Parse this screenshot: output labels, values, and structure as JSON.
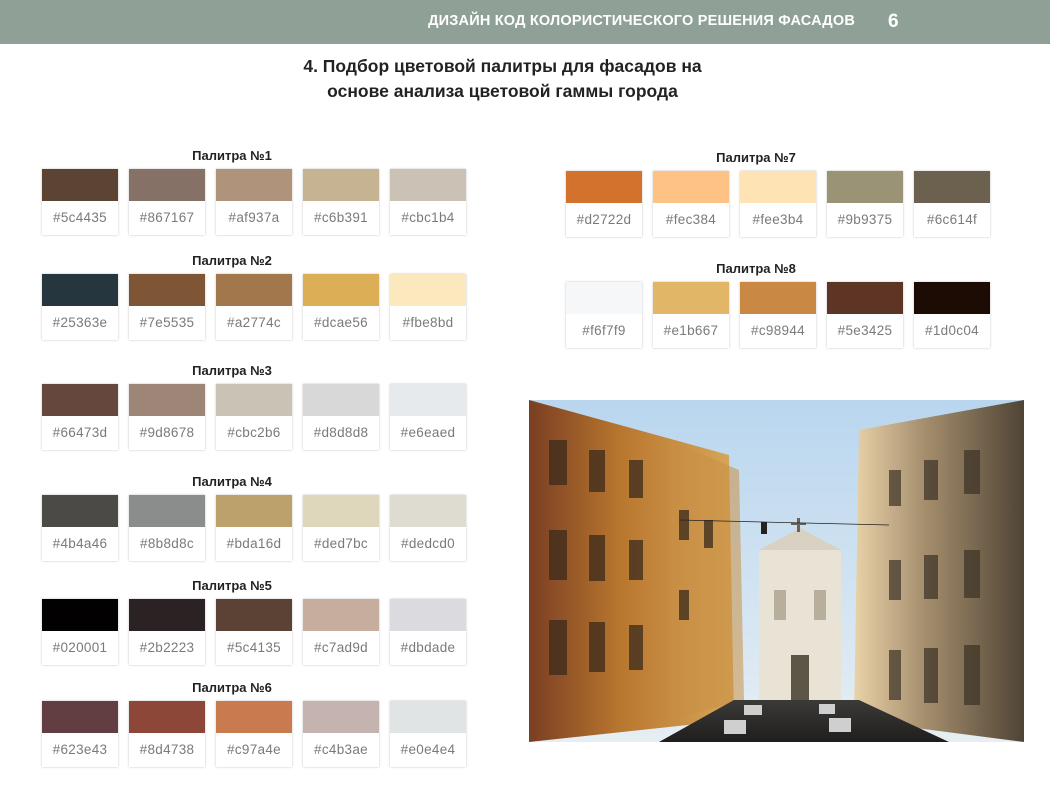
{
  "header": {
    "title": "ДИЗАЙН КОД КОЛОРИСТИЧЕСКОГО РЕШЕНИЯ ФАСАДОВ",
    "page_number": "6"
  },
  "section": {
    "title_line1": "4.  Подбор цветовой палитры для фасадов на",
    "title_line2": "основе анализа цветовой гаммы города"
  },
  "palettes": [
    {
      "title": "Палитра №1",
      "colors": [
        "#5c4435",
        "#867167",
        "#af937a",
        "#c6b391",
        "#cbc1b4"
      ]
    },
    {
      "title": "Палитра №2",
      "colors": [
        "#25363e",
        "#7e5535",
        "#a2774c",
        "#dcae56",
        "#fbe8bd"
      ]
    },
    {
      "title": "Палитра №3",
      "colors": [
        "#66473d",
        "#9d8678",
        "#cbc2b6",
        "#d8d8d8",
        "#e6eaed"
      ]
    },
    {
      "title": "Палитра №4",
      "colors": [
        "#4b4a46",
        "#8b8d8c",
        "#bda16d",
        "#ded7bc",
        "#dedcd0"
      ]
    },
    {
      "title": "Палитра №5",
      "colors": [
        "#020001",
        "#2b2223",
        "#5c4135",
        "#c7ad9d",
        "#dbdade"
      ]
    },
    {
      "title": "Палитра №6",
      "colors": [
        "#623e43",
        "#8d4738",
        "#c97a4e",
        "#c4b3ae",
        "#e0e4e4"
      ]
    },
    {
      "title": "Палитра №7",
      "colors": [
        "#d2722d",
        "#fec384",
        "#fee3b4",
        "#9b9375",
        "#6c614f"
      ]
    },
    {
      "title": "Палитра №8",
      "colors": [
        "#f6f7f9",
        "#e1b667",
        "#c98944",
        "#5e3425",
        "#1d0c04"
      ]
    }
  ]
}
